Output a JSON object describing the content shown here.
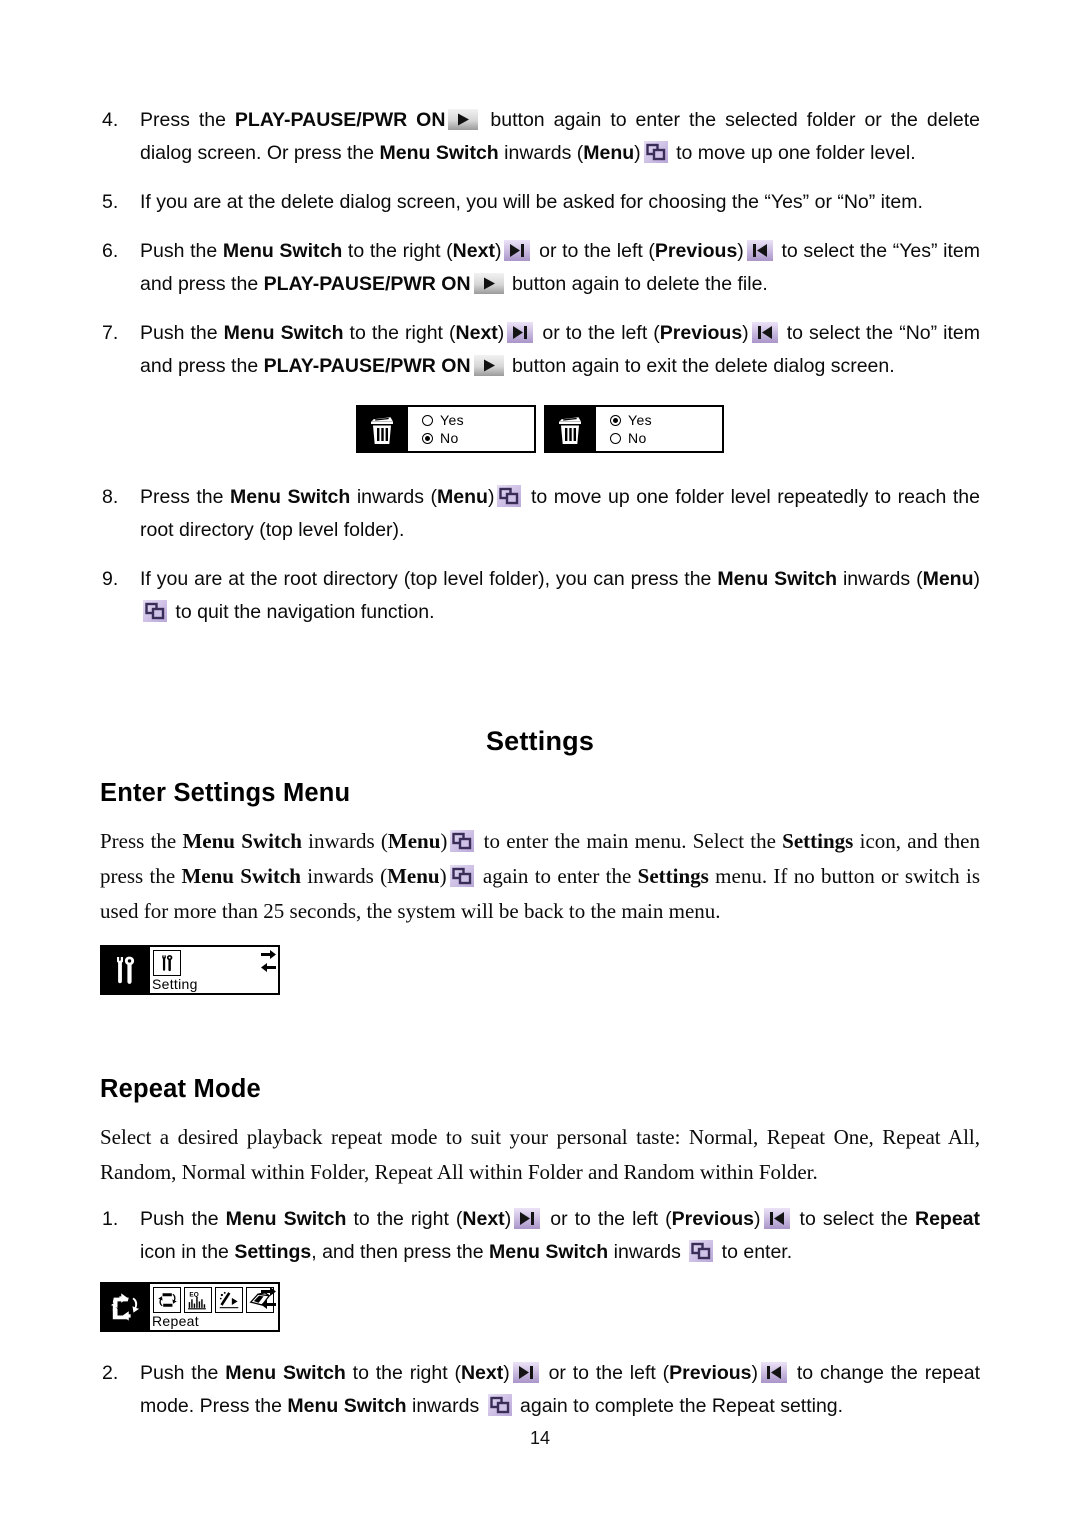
{
  "document": {
    "page_number": "14"
  },
  "icons": {
    "play_pause_pwr_on": "play-button-icon",
    "menu": "menu-switch-inwards-icon",
    "next": "next-skip-forward-icon",
    "previous": "previous-skip-backward-icon"
  },
  "colors": {
    "icon_purple_light": "#cfc2e6",
    "icon_purple_dark": "#6e5b96",
    "icon_gray_light": "#e8e8e8",
    "icon_gray_dark": "#8c8c8c",
    "text": "#0a0a0a"
  },
  "steps_navigation": [
    {
      "number": "4.",
      "segments": [
        {
          "t": "Press the ",
          "b": false
        },
        {
          "t": "PLAY-PAUSE/PWR ON",
          "b": true
        },
        {
          "icon": "play"
        },
        {
          "t": " button again to enter the selected folder or the delete dialog screen. Or press the ",
          "b": false
        },
        {
          "t": "Menu Switch",
          "b": true
        },
        {
          "t": " inwards (",
          "b": false
        },
        {
          "t": "Menu",
          "b": true
        },
        {
          "t": ")",
          "b": false
        },
        {
          "icon": "menu"
        },
        {
          "t": " to move up one folder level.",
          "b": false
        }
      ]
    },
    {
      "number": "5.",
      "segments": [
        {
          "t": "If you are at the delete dialog screen, you will be asked for choosing the “Yes” or “No” item.",
          "b": false
        }
      ]
    },
    {
      "number": "6.",
      "segments": [
        {
          "t": "Push the ",
          "b": false
        },
        {
          "t": "Menu Switch",
          "b": true
        },
        {
          "t": " to the right (",
          "b": false
        },
        {
          "t": "Next",
          "b": true
        },
        {
          "t": ")",
          "b": false
        },
        {
          "icon": "next"
        },
        {
          "t": " or to the left (",
          "b": false
        },
        {
          "t": "Previous",
          "b": true
        },
        {
          "t": ")",
          "b": false
        },
        {
          "icon": "prev"
        },
        {
          "t": " to select the “Yes” item and press the ",
          "b": false
        },
        {
          "t": "PLAY-PAUSE/PWR ON",
          "b": true
        },
        {
          "icon": "play"
        },
        {
          "t": " button again to delete the file.",
          "b": false
        }
      ]
    },
    {
      "number": "7.",
      "segments": [
        {
          "t": "Push the ",
          "b": false
        },
        {
          "t": "Menu Switch",
          "b": true
        },
        {
          "t": " to the right (",
          "b": false
        },
        {
          "t": "Next",
          "b": true
        },
        {
          "t": ")",
          "b": false
        },
        {
          "icon": "next"
        },
        {
          "t": " or to the left (",
          "b": false
        },
        {
          "t": "Previous",
          "b": true
        },
        {
          "t": ")",
          "b": false
        },
        {
          "icon": "prev"
        },
        {
          "t": " to select the “No” item and press the ",
          "b": false
        },
        {
          "t": "PLAY-PAUSE/PWR ON",
          "b": true
        },
        {
          "icon": "play"
        },
        {
          "t": " button again to exit the delete dialog screen.",
          "b": false
        }
      ]
    }
  ],
  "delete_dialogs": [
    {
      "name": "delete-dialog-no-selected",
      "icon": "trash-can-icon",
      "options": [
        {
          "label": "Yes",
          "selected": false
        },
        {
          "label": "No",
          "selected": true
        }
      ]
    },
    {
      "name": "delete-dialog-yes-selected",
      "icon": "trash-can-icon",
      "options": [
        {
          "label": "Yes",
          "selected": true
        },
        {
          "label": "No",
          "selected": false
        }
      ]
    }
  ],
  "steps_navigation_tail": [
    {
      "number": "8.",
      "segments": [
        {
          "t": "Press the ",
          "b": false
        },
        {
          "t": "Menu Switch",
          "b": true
        },
        {
          "t": " inwards (",
          "b": false
        },
        {
          "t": "Menu",
          "b": true
        },
        {
          "t": ")",
          "b": false
        },
        {
          "icon": "menu"
        },
        {
          "t": " to move up one folder level repeatedly to reach the root directory (top level folder).",
          "b": false
        }
      ]
    },
    {
      "number": "9.",
      "segments": [
        {
          "t": "If you are at the root directory (top level folder), you can press the ",
          "b": false
        },
        {
          "t": "Menu Switch",
          "b": true
        },
        {
          "t": " inwards (",
          "b": false
        },
        {
          "t": "Menu",
          "b": true
        },
        {
          "t": ")",
          "b": false
        },
        {
          "icon": "menu"
        },
        {
          "t": " to quit the navigation function.",
          "b": false
        }
      ]
    }
  ],
  "settings_section": {
    "title": "Settings",
    "subtitle": "Enter Settings Menu",
    "paragraph": [
      {
        "t": "Press the ",
        "b": false
      },
      {
        "t": "Menu Switch",
        "b": true
      },
      {
        "t": " inwards (",
        "b": false
      },
      {
        "t": "Menu",
        "b": true
      },
      {
        "t": ")",
        "b": false
      },
      {
        "icon": "menu"
      },
      {
        "t": " to enter the main menu. Select the ",
        "b": false
      },
      {
        "t": "Settings",
        "b": true
      },
      {
        "t": " icon, and then press the ",
        "b": false
      },
      {
        "t": "Menu Switch",
        "b": true
      },
      {
        "t": " inwards (",
        "b": false
      },
      {
        "t": "Menu",
        "b": true
      },
      {
        "t": ")",
        "b": false
      },
      {
        "icon": "menu"
      },
      {
        "t": " again to enter the ",
        "b": false
      },
      {
        "t": "Settings",
        "b": true
      },
      {
        "t": " menu. If no button or switch is used for more than 25 seconds, the system will be back to the main menu.",
        "b": false
      }
    ],
    "lcd": {
      "name": "settings-lcd-screen",
      "selected_icon": "tools-wrench-screwdriver-icon",
      "tiles": [
        "tools-wrench-screwdriver-icon"
      ],
      "label": "Setting",
      "arrows": [
        "arrow-right-icon",
        "arrow-left-icon"
      ]
    }
  },
  "repeat_section": {
    "title": "Repeat Mode",
    "paragraph": "Select a desired playback repeat mode to suit your personal taste: Normal, Repeat One, Repeat All, Random, Normal within Folder, Repeat All within Folder and Random within Folder.",
    "repeat_modes": [
      "Normal",
      "Repeat One",
      "Repeat All",
      "Random",
      "Normal within Folder",
      "Repeat All within Folder",
      "Random within Folder"
    ],
    "steps": [
      {
        "number": "1.",
        "segments": [
          {
            "t": "Push the ",
            "b": false
          },
          {
            "t": "Menu Switch",
            "b": true
          },
          {
            "t": " to the right (",
            "b": false
          },
          {
            "t": "Next",
            "b": true
          },
          {
            "t": ")",
            "b": false
          },
          {
            "icon": "next"
          },
          {
            "t": " or to the left (",
            "b": false
          },
          {
            "t": "Previous",
            "b": true
          },
          {
            "t": ")",
            "b": false
          },
          {
            "icon": "prev"
          },
          {
            "t": " to select the ",
            "b": false
          },
          {
            "t": "Repeat",
            "b": true
          },
          {
            "t": " icon in the ",
            "b": false
          },
          {
            "t": "Settings",
            "b": true
          },
          {
            "t": ", and then press the ",
            "b": false
          },
          {
            "t": "Menu Switch",
            "b": true
          },
          {
            "t": " inwards ",
            "b": false
          },
          {
            "icon": "menu"
          },
          {
            "t": " to enter.",
            "b": false
          }
        ]
      },
      {
        "number": "2.",
        "segments": [
          {
            "t": "Push the ",
            "b": false
          },
          {
            "t": "Menu Switch",
            "b": true
          },
          {
            "t": " to the right (",
            "b": false
          },
          {
            "t": "Next",
            "b": true
          },
          {
            "t": ")",
            "b": false
          },
          {
            "icon": "next"
          },
          {
            "t": " or to the left (",
            "b": false
          },
          {
            "t": "Previous",
            "b": true
          },
          {
            "t": ")",
            "b": false
          },
          {
            "icon": "prev"
          },
          {
            "t": " to change the repeat mode. Press the ",
            "b": false
          },
          {
            "t": "Menu Switch",
            "b": true
          },
          {
            "t": " inwards ",
            "b": false
          },
          {
            "icon": "menu"
          },
          {
            "t": " again to complete the Repeat setting.",
            "b": false
          }
        ]
      }
    ],
    "lcd": {
      "name": "repeat-lcd-screen",
      "selected_icon": "repeat-arrows-icon",
      "tiles": [
        "repeat-arrows-icon",
        "equalizer-icon",
        "play-effect-icon",
        "contrast-pages-icon"
      ],
      "label": "Repeat",
      "arrows": [
        "arrow-right-icon",
        "arrow-left-icon"
      ]
    }
  }
}
